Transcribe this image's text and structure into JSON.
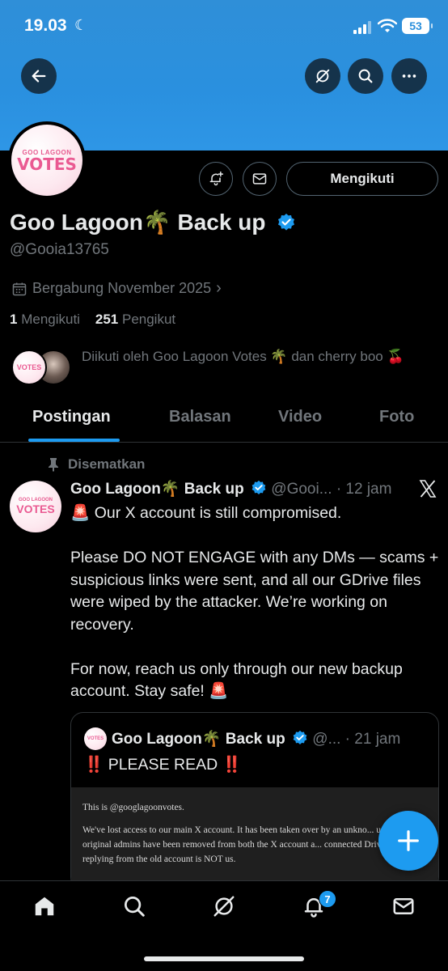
{
  "status_bar": {
    "time": "19.03",
    "battery": "53"
  },
  "profile": {
    "avatar_text_top": "GOO LAGOON",
    "avatar_text_main": "VOTES",
    "name": "Goo Lagoon🌴 Back up",
    "handle": "@Gooia13765",
    "joined": "Bergabung November 2025",
    "following_count": "1",
    "following_label": "Mengikuti",
    "followers_count": "251",
    "followers_label": "Pengikut",
    "followed_by": "Diikuti oleh Goo Lagoon Votes 🌴 dan cherry boo 🍒",
    "follow_button": "Mengikuti"
  },
  "tabs": [
    {
      "label": "Postingan",
      "active": true
    },
    {
      "label": "Balasan",
      "active": false
    },
    {
      "label": "Video",
      "active": false
    },
    {
      "label": "Foto",
      "active": false
    }
  ],
  "post": {
    "pinned_label": "Disematkan",
    "name": "Goo Lagoon🌴 Back up",
    "handle_time": "@Gooi... · 12 jam",
    "body": "🚨 Our X account is still compromised.\n\nPlease DO NOT ENGAGE with any DMs — scams + suspicious links were sent, and all our GDrive files were wiped by the attacker. We’re working on recovery.\n\nFor now, reach us only through our new backup account. Stay safe! 🚨"
  },
  "quote": {
    "name": "Goo Lagoon🌴 Back up",
    "handle_time": "@... · 21 jam",
    "text": "‼️ PLEASE READ ‼️",
    "image_line1": "This is @googlagoonvotes.",
    "image_line2": "We've lost access to our main X account. It has been taken over by an unkno... user, and all original admins have been removed from both the X account a... connected Drive. Anyone replying from the old account is NOT us."
  },
  "nav": {
    "notifications_badge": "7"
  },
  "colors": {
    "accent": "#1d9bf0",
    "banner": "#2a90df",
    "muted": "#71767b"
  }
}
